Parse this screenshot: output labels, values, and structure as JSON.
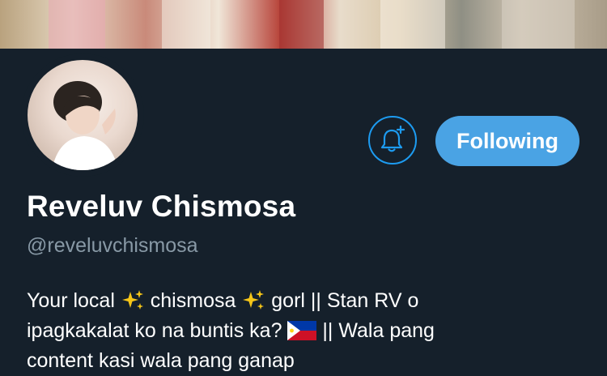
{
  "profile": {
    "display_name": "Reveluv Chismosa",
    "handle": "@reveluvchismosa",
    "bio": {
      "line1_a": "Your local",
      "line1_b": "chismosa",
      "line1_c": "gorl || Stan RV o",
      "line2_a": "ipagkakalat ko na buntis ka?",
      "line2_b": "|| Wala pang",
      "line3": "content kasi wala pang ganap"
    }
  },
  "actions": {
    "notify_icon": "bell-plus-icon",
    "follow_label": "Following"
  },
  "colors": {
    "background": "#15202b",
    "accent": "#4aa3e4",
    "secondary_text": "#8899a6"
  }
}
